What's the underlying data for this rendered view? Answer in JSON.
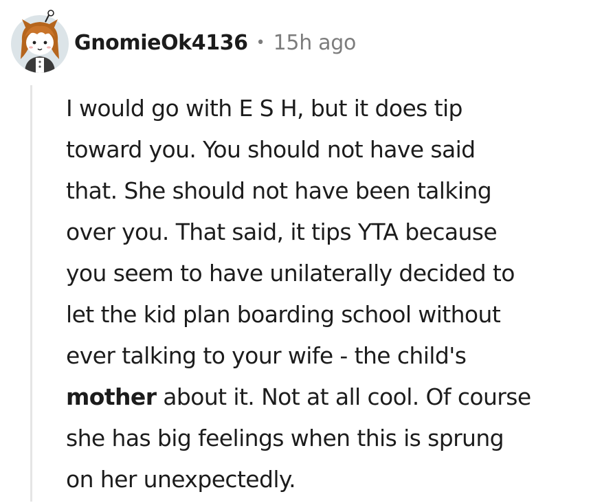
{
  "comment": {
    "avatar_icon": "snoo-avatar-icon",
    "username": "GnomieOk4136",
    "separator": "•",
    "timestamp": "15h ago",
    "body": {
      "line1": "I would go with E S H, but it does tip",
      "line2": "toward you. You should not have said",
      "line3": "that. She should not have been talking",
      "line4": "over you. That said, it tips YTA because",
      "line5": "you seem to have unilaterally decided to",
      "line6": "let the kid plan boarding school without",
      "line7": "ever talking to your wife - the child's",
      "line8_bold": "mother",
      "line8_rest": " about it. Not at all cool. Of course",
      "line9": "she has big feelings when this is sprung",
      "line10": "on her unexpectedly."
    }
  },
  "colors": {
    "text": "#1c1c1c",
    "meta": "#7c7c7c",
    "thread_line": "#e5e5e5",
    "avatar_bg": "#dce4e8",
    "avatar_hair": "#b5651d"
  }
}
